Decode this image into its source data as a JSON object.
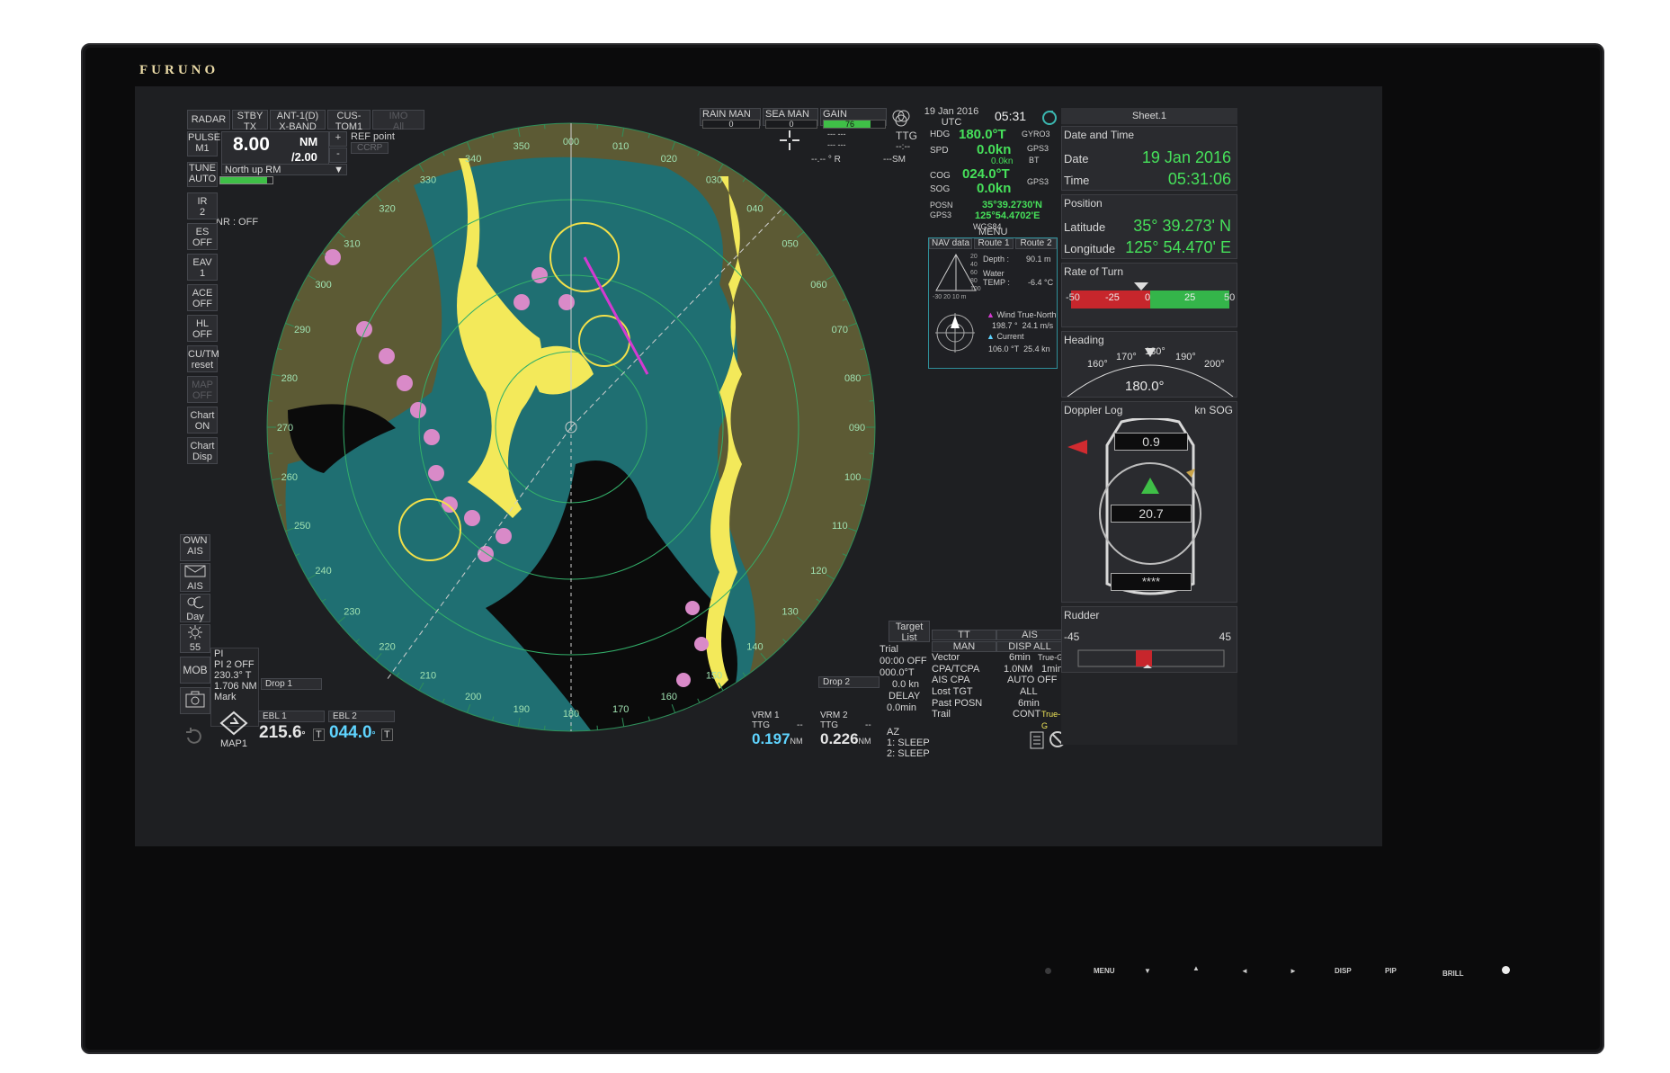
{
  "brand": "FURUNO",
  "top_bar": {
    "radar": "RADAR",
    "stby": "STBY",
    "tx": "TX",
    "antenna": "ANT-1(D)",
    "band": "X-BAND",
    "custom": "CUS-",
    "custom2": "TOM1",
    "imo": "IMO",
    "imo2": "All",
    "rain": "RAIN",
    "rain_man": "MAN",
    "rain_val": "0",
    "sea": "SEA",
    "sea_man": "MAN",
    "sea_val": "0",
    "gain": "GAIN",
    "gain_val": "76",
    "date": "19 Jan 2016",
    "utc": "UTC",
    "time": "05:31"
  },
  "range": {
    "pulse": "PULSE",
    "pulse_val": "M1",
    "value": "8.00",
    "unit": "NM",
    "ring": "/2.00",
    "plus": "+",
    "minus": "-",
    "ref": "REF point",
    "ccrp": "CCRP",
    "mode": "North up RM",
    "tune": "TUNE",
    "tune_val": "AUTO"
  },
  "left_menu": [
    {
      "a": "IR",
      "b": "2"
    },
    {
      "a": "ES",
      "b": "OFF"
    },
    {
      "a": "EAV",
      "b": "1"
    },
    {
      "a": "ACE",
      "b": "OFF"
    },
    {
      "a": "HL",
      "b": "OFF"
    },
    {
      "a": "CU/TM",
      "b": "reset"
    },
    {
      "a": "MAP",
      "b": "OFF"
    },
    {
      "a": "Chart",
      "b": "ON"
    },
    {
      "a": "Chart",
      "b": "Disp"
    }
  ],
  "nr": "NR : OFF",
  "left_lower": {
    "own": "OWN",
    "ais": "AIS",
    "ais2": "AIS",
    "day": "Day",
    "brill": "55",
    "mob": "MOB",
    "map1": "MAP1"
  },
  "pi": {
    "pi": "PI",
    "pi2": "PI 2",
    "off": "OFF",
    "bearing": "230.3",
    "t": "T",
    "dist": "1.706 NM",
    "mark": "Mark"
  },
  "ebl": {
    "drop1": "Drop 1",
    "ebl1": "EBL 1",
    "ebl1_val": "215.6",
    "ebl2": "EBL 2",
    "ebl2_val": "044.0",
    "deg": "°",
    "t": "T"
  },
  "vrm": {
    "drop2": "Drop 2",
    "vrm1": "VRM 1",
    "ttg": "TTG",
    "dash": "--",
    "vrm1_val": "0.197",
    "vrm2": "VRM 2",
    "vrm2_val": "0.226",
    "nm": "NM"
  },
  "bearings": [
    "350",
    "000",
    "010",
    "020",
    "030",
    "040",
    "050",
    "060",
    "070",
    "080",
    "090",
    "100",
    "110",
    "120",
    "130",
    "140",
    "150",
    "160",
    "170",
    "180",
    "190",
    "200",
    "210",
    "220",
    "230",
    "240",
    "250",
    "260",
    "270",
    "280",
    "290",
    "300",
    "310",
    "320",
    "330",
    "340"
  ],
  "cursor": {
    "dashes1": "--- ---",
    "dashes2": "--- ---",
    "dashes3": "--.--",
    "r": "R",
    "sm": "SM",
    "ttg": "TTG",
    "ttg_val": "--:--"
  },
  "own_ship": {
    "hdg": "HDG",
    "hdg_val": "180.0°T",
    "hdg_src": "GYRO3",
    "spd": "SPD",
    "spd_val": "0.0kn",
    "spd_src": "GPS3",
    "spd_sub": "0.0kn",
    "bt": "BT",
    "cog": "COG",
    "cog_val": "024.0°T",
    "sog": "SOG",
    "sog_val": "0.0kn",
    "cog_src": "GPS3",
    "posn": "POSN",
    "lat": "35°39.2730'N",
    "gps": "GPS3",
    "lon": "125°54.4702'E",
    "datum": "WGS84"
  },
  "nav_data": {
    "menu": "MENU",
    "tab1": "NAV data",
    "tab2": "Route 1",
    "tab3": "Route 2",
    "depth_label": "Depth :",
    "depth": "90.1 m",
    "water": "Water",
    "temp_label": "TEMP :",
    "temp": "-6.4 °C",
    "wind": "Wind True-North",
    "wind_dir": "198.7 °",
    "wind_spd": "24.1 m/s",
    "current": "Current",
    "cur_dir": "106.0 °T",
    "cur_spd": "25.4 kn",
    "scale": [
      "20",
      "40",
      "60",
      "80",
      "100"
    ],
    "scale2": [
      "-30",
      "20",
      "10",
      "m"
    ]
  },
  "target": {
    "list": "Target",
    "list2": "List",
    "tt": "TT",
    "ais": "AIS",
    "man": "MAN",
    "disp_all": "DISP ALL",
    "trial": "Trial",
    "trial_time": "00:00",
    "off": "OFF",
    "trial_hdg": "000.0°T",
    "trial_spd": "0.0 kn",
    "delay": "DELAY",
    "delay_val": "0.0min",
    "vector": "Vector",
    "vector_val": "6min",
    "vector_mode": "True-G",
    "cpa": "CPA/TCPA",
    "cpa_val": "1.0NM",
    "tcpa_val": "1min",
    "ais_cpa": "AIS CPA",
    "ais_cpa_val": "AUTO OFF",
    "lost": "Lost TGT",
    "lost_val": "ALL",
    "past": "Past POSN",
    "past_val": "6min",
    "trail": "Trail",
    "trail_val": "CONT",
    "trail_mode": "True-G",
    "az": "AZ",
    "az1": "1:",
    "az1_val": "SLEEP",
    "az2": "2:",
    "az2_val": "SLEEP"
  },
  "sheet": {
    "title": "Sheet.1",
    "date_time": "Date and Time",
    "date_label": "Date",
    "date": "19 Jan 2016",
    "time_label": "Time",
    "time": "05:31:06",
    "position": "Position",
    "lat_label": "Latitude",
    "lat": "35° 39.273' N",
    "lon_label": "Longitude",
    "lon": "125° 54.470' E",
    "rot": "Rate of Turn",
    "rot_scale": [
      "-50",
      "-25",
      "0",
      "25",
      "50"
    ],
    "heading": "Heading",
    "heading_scale": [
      "160°",
      "170°",
      "180°",
      "190°",
      "200°"
    ],
    "heading_val": "180.0°",
    "doppler": "Doppler Log",
    "doppler_unit": "kn SOG",
    "doppler_fwd": "0.9",
    "doppler_spd": "20.7",
    "doppler_aft": "****",
    "rudder": "Rudder",
    "rudder_left": "-45",
    "rudder_right": "45"
  },
  "hardware_keys": [
    "MENU",
    "▼",
    "▲",
    "◄",
    "►",
    "DISP",
    "PIP",
    "BRILL"
  ],
  "colors": {
    "sea": "#1f6f72",
    "land": "#5c5a34",
    "echo": "#f3e95a",
    "ais_targets": "#d98ac8",
    "readout": "#46e05a"
  }
}
